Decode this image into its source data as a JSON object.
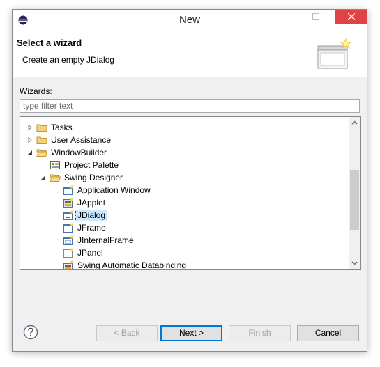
{
  "window": {
    "title": "New"
  },
  "header": {
    "title": "Select a wizard",
    "description": "Create an empty JDialog"
  },
  "wizards_label": "Wizards:",
  "filter": {
    "placeholder": "type filter text",
    "value": ""
  },
  "tree": {
    "items": [
      {
        "label": "Tasks",
        "icon": "folder-icon",
        "expanded": false,
        "depth": 0
      },
      {
        "label": "User Assistance",
        "icon": "folder-icon",
        "expanded": false,
        "depth": 0
      },
      {
        "label": "WindowBuilder",
        "icon": "folder-open-icon",
        "expanded": true,
        "depth": 0
      },
      {
        "label": "Project Palette",
        "icon": "palette-icon",
        "depth": 1
      },
      {
        "label": "Swing Designer",
        "icon": "folder-open-icon",
        "expanded": true,
        "depth": 1
      },
      {
        "label": "Application Window",
        "icon": "window-icon",
        "depth": 2
      },
      {
        "label": "JApplet",
        "icon": "applet-icon",
        "depth": 2
      },
      {
        "label": "JDialog",
        "icon": "dialog-icon",
        "depth": 2,
        "selected": true
      },
      {
        "label": "JFrame",
        "icon": "frame-icon",
        "depth": 2
      },
      {
        "label": "JInternalFrame",
        "icon": "internal-frame-icon",
        "depth": 2
      },
      {
        "label": "JPanel",
        "icon": "panel-icon",
        "depth": 2
      },
      {
        "label": "Swing Automatic Databinding",
        "icon": "databinding-icon",
        "depth": 2
      }
    ]
  },
  "buttons": {
    "back": "< Back",
    "next": "Next >",
    "finish": "Finish",
    "cancel": "Cancel"
  },
  "colors": {
    "close_button": "#e04343",
    "selection": "#cce8ff",
    "default_button_border": "#0078d7"
  }
}
